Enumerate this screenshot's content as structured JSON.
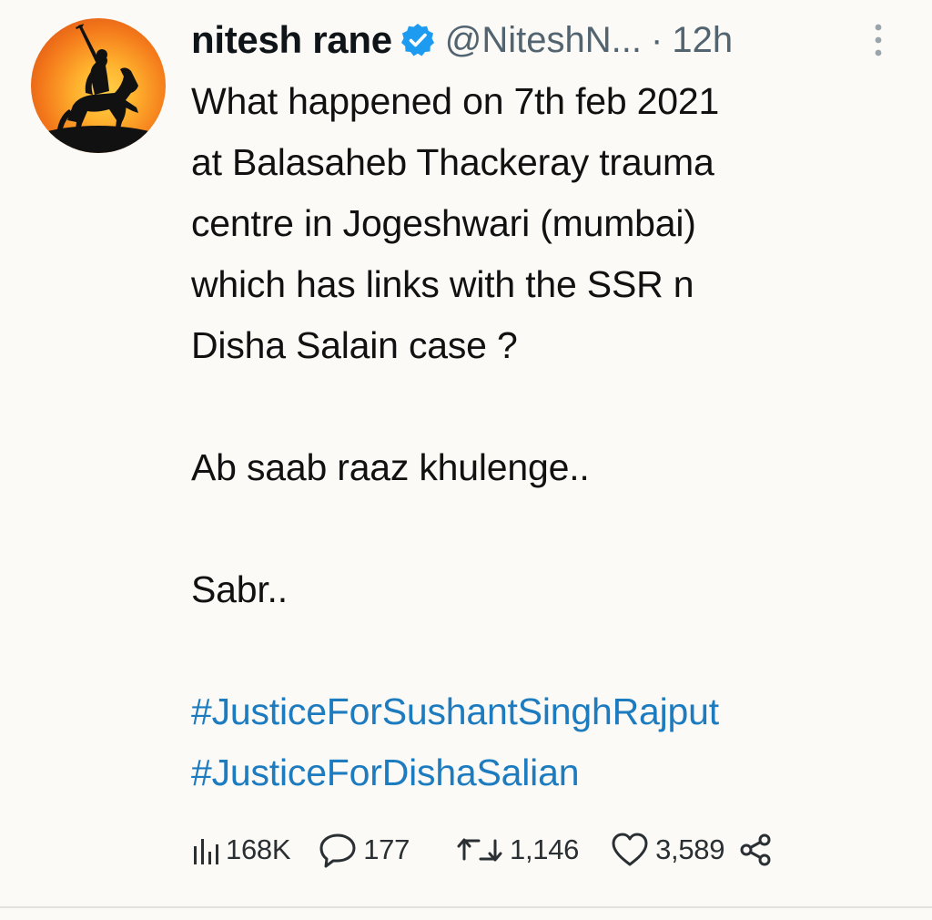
{
  "tweet": {
    "author": {
      "name": "nitesh rane",
      "handle": "@NiteshN...",
      "verified_icon": "verified-badge-icon",
      "avatar_icon": "horseman-silhouette-avatar"
    },
    "separator": "·",
    "timestamp": "12h",
    "text_lines": [
      "What happened on 7th feb 2021",
      "at Balasaheb Thackeray trauma",
      "centre in Jogeshwari (mumbai)",
      "which has links with the SSR n",
      "Disha Salain case ?"
    ],
    "line_2": "Ab saab raaz khulenge..",
    "line_3": "Sabr..",
    "hashtags": [
      "#JusticeForSushantSinghRajput",
      "#JusticeForDishaSalian"
    ],
    "metrics": {
      "views": "168K",
      "replies": "177",
      "retweets": "1,146",
      "likes": "3,589"
    }
  },
  "colors": {
    "background": "#fbfaf6",
    "text": "#111111",
    "secondary": "#536471",
    "hashtag": "#1d7bbf",
    "verified": "#1d9bf0"
  }
}
